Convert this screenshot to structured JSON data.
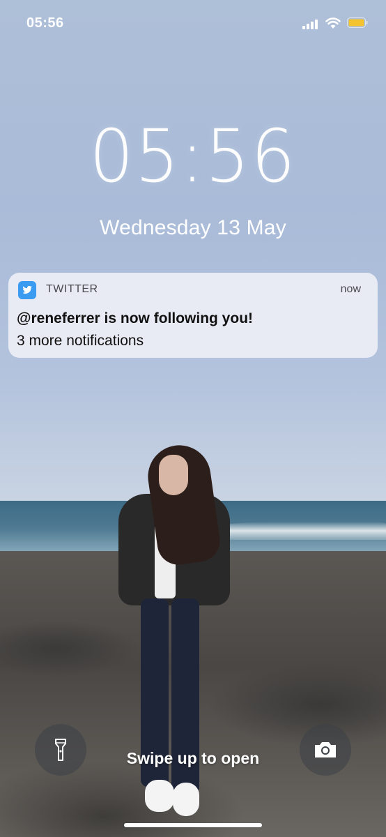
{
  "status_bar": {
    "time": "05:56",
    "signal_icon": "signal-bars-icon",
    "wifi_icon": "wifi-icon",
    "battery_icon": "battery-icon",
    "battery_color": "#f4c430"
  },
  "lock_screen": {
    "clock": "05:56",
    "date": "Wednesday 13 May"
  },
  "notification": {
    "app_icon": "twitter-bird-icon",
    "app_color": "#3a9bf0",
    "app_name": "TWITTER",
    "time": "now",
    "title": "@reneferrer is now following you!",
    "body": "3 more notifications"
  },
  "bottom": {
    "flashlight_icon": "flashlight-icon",
    "camera_icon": "camera-icon",
    "swipe_text": "Swipe up to open"
  }
}
